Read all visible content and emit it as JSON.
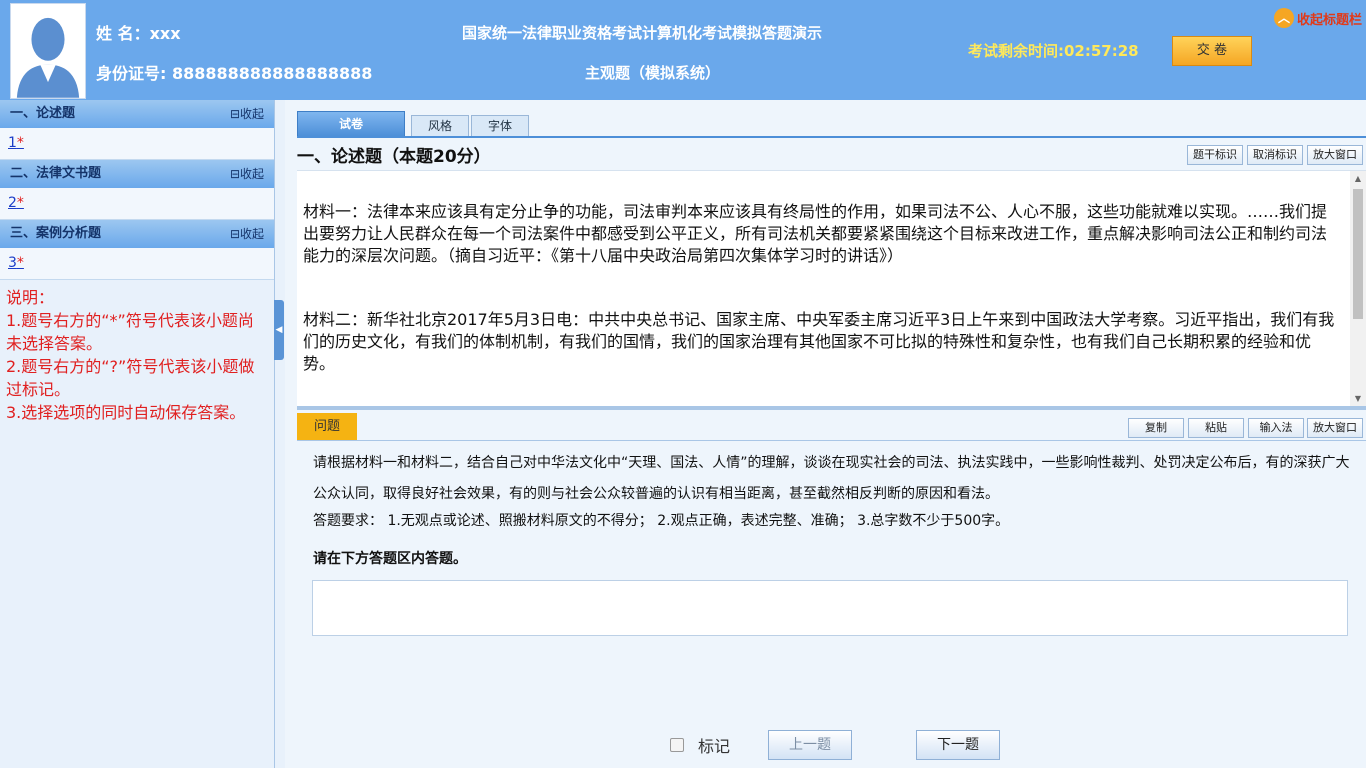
{
  "header": {
    "name_label": "姓 名：xxx",
    "id_label": "身份证号: 888888888888888888",
    "title_main": "国家统一法律职业资格考试计算机化考试模拟答题演示",
    "title_sub": "主观题（模拟系统）",
    "timer": "考试剩余时间:02:57:28",
    "submit_label": "交 卷",
    "collapse_label": "收起标题栏"
  },
  "sidebar": {
    "fold_label": "⊟收起",
    "sections": [
      {
        "title": "一、论述题",
        "item": "1",
        "star": "*"
      },
      {
        "title": "二、法律文书题",
        "item": "2",
        "star": "*"
      },
      {
        "title": "三、案例分析题",
        "item": "3",
        "star": "*"
      }
    ],
    "notes": [
      "说明：",
      "1.题号右方的“*”符号代表该小题尚未选择答案。",
      "2.题号右方的“?”符号代表该小题做过标记。",
      "3.选择选项的同时自动保存答案。"
    ]
  },
  "tabs": [
    "试卷",
    "风格",
    "字体"
  ],
  "section_title": "一、论述题（本题20分）",
  "material_tools": [
    "题干标识",
    "取消标识",
    "放大窗口"
  ],
  "material": {
    "para1": "材料一：法律本来应该具有定分止争的功能，司法审判本来应该具有终局性的作用，如果司法不公、人心不服，这些功能就难以实现。……我们提出要努力让人民群众在每一个司法案件中都感受到公平正义，所有司法机关都要紧紧围绕这个目标来改进工作，重点解决影响司法公正和制约司法能力的深层次问题。（摘自习近平：《第十八届中央政治局第四次集体学习时的讲话》）",
    "para2": "材料二：新华社北京2017年5月3日电：中共中央总书记、国家主席、中央军委主席习近平3日上午来到中国政法大学考察。习近平指出，我们有我们的历史文化，有我们的体制机制，有我们的国情，我们的国家治理有其他国家不可比拟的特殊性和复杂性，也有我们自己长期积累的经验和优势。"
  },
  "question_tab": "问题",
  "question_tools": [
    "复制",
    "粘贴",
    "输入法",
    "放大窗口"
  ],
  "question": {
    "text": "请根据材料一和材料二，结合自己对中华法文化中“天理、国法、人情”的理解，谈谈在现实社会的司法、执法实践中，一些影响性裁判、处罚决定公布后，有的深获广大公众认同，取得良好社会效果，有的则与社会公众较普遍的认识有相当距离，甚至截然相反判断的原因和看法。",
    "requirement": "答题要求： 1.无观点或论述、照搬材料原文的不得分； 2.观点正确，表述完整、准确； 3.总字数不少于500字。",
    "instruction": "请在下方答题区内答题。"
  },
  "footer": {
    "mark_label": "标记",
    "prev_label": "上一题",
    "next_label": "下一题"
  }
}
